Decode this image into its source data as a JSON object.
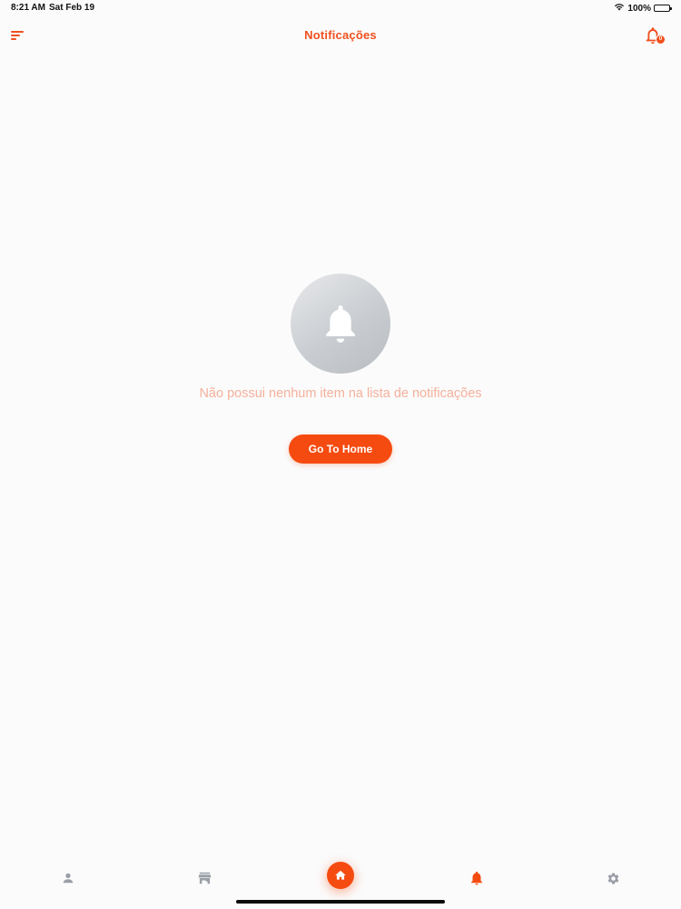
{
  "status_bar": {
    "time": "8:21 AM",
    "date": "Sat Feb 19",
    "battery": "100%"
  },
  "header": {
    "title": "Notificações",
    "notification_badge": "0"
  },
  "empty_state": {
    "message": "Não possui nenhum item na lista de notificações",
    "button_label": "Go To Home",
    "icon": "bell-icon"
  },
  "bottom_nav": {
    "items": [
      {
        "icon": "person-icon",
        "active": false
      },
      {
        "icon": "store-icon",
        "active": false
      },
      {
        "icon": "home-icon",
        "active": false
      },
      {
        "icon": "bell-icon",
        "active": true
      },
      {
        "icon": "gear-icon",
        "active": false
      }
    ]
  },
  "colors": {
    "accent": "#f54b10",
    "title": "#f0501e",
    "message": "#f6b09b",
    "inactive_icon": "#9a9ea6",
    "background": "#fbfbfb"
  }
}
